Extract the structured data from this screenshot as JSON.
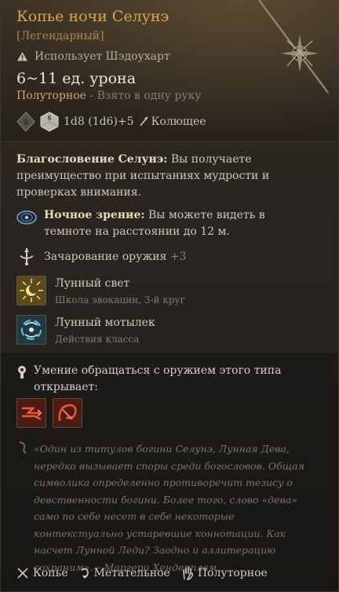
{
  "item": {
    "name": "Копье ночи Селунэ",
    "rarity": "[Легендарный]",
    "requirement": "Использует Шэдоухарт",
    "damage_range": "6~11 ед. урона",
    "handedness": "Полуторное",
    "handedness_note": "- Взято в одну руку",
    "dice_formula": "1d8 (1d6)+5",
    "damage_type": "Колющее",
    "die_left_label": "8",
    "die_right_label": "6"
  },
  "blessing": {
    "name": "Благословение Селунэ:",
    "text": " Вы получаете преимущество при испытаниях мудрости и проверках внимания."
  },
  "darkvision": {
    "name": "Ночное зрение:",
    "text": " Вы можете видеть в темноте на расстоянии до 12 м."
  },
  "enchantment": {
    "label": "Зачарование оружия",
    "value": "+3"
  },
  "spells": [
    {
      "name": "Лунный свет",
      "sub": "Школа эвокации, 3-й круг"
    },
    {
      "name": "Лунный мотылек",
      "sub": "Действия класса"
    }
  ],
  "proficiency": {
    "text": "Умение обращаться с оружием этого типа открывает:"
  },
  "lore": "«Один из титулов богини Селунэ, Лунная Дева, нередко вызывает споры среди богословов. Общая символика определенно противоречит тезису о девственности богини. Более того, слово «дева» само по себе несет в себе некоторые контекстуально устаревшие коннотации. Как насчет Лунной Леди? Заодно и аллитерацию сохраним». – Маргери Хендерплам",
  "footer": {
    "tag1": "Копье",
    "tag2": "Метательное",
    "tag3": "Полуторное"
  },
  "colors": {
    "title": "#d7a64d",
    "rarity": "#b0874a",
    "accent": "#d2ae6a"
  },
  "icons": [
    "warning-icon",
    "d8-die-icon",
    "d6-die-icon",
    "piercing-icon",
    "darkvision-eye-icon",
    "enchant-icon",
    "moonbeam-spell-icon",
    "moon-moth-icon",
    "proficiency-icon",
    "ability-icon-1",
    "ability-icon-2",
    "lore-quill-icon",
    "spear-icon",
    "thrown-icon",
    "versatile-hand-icon",
    "spear-artwork"
  ]
}
